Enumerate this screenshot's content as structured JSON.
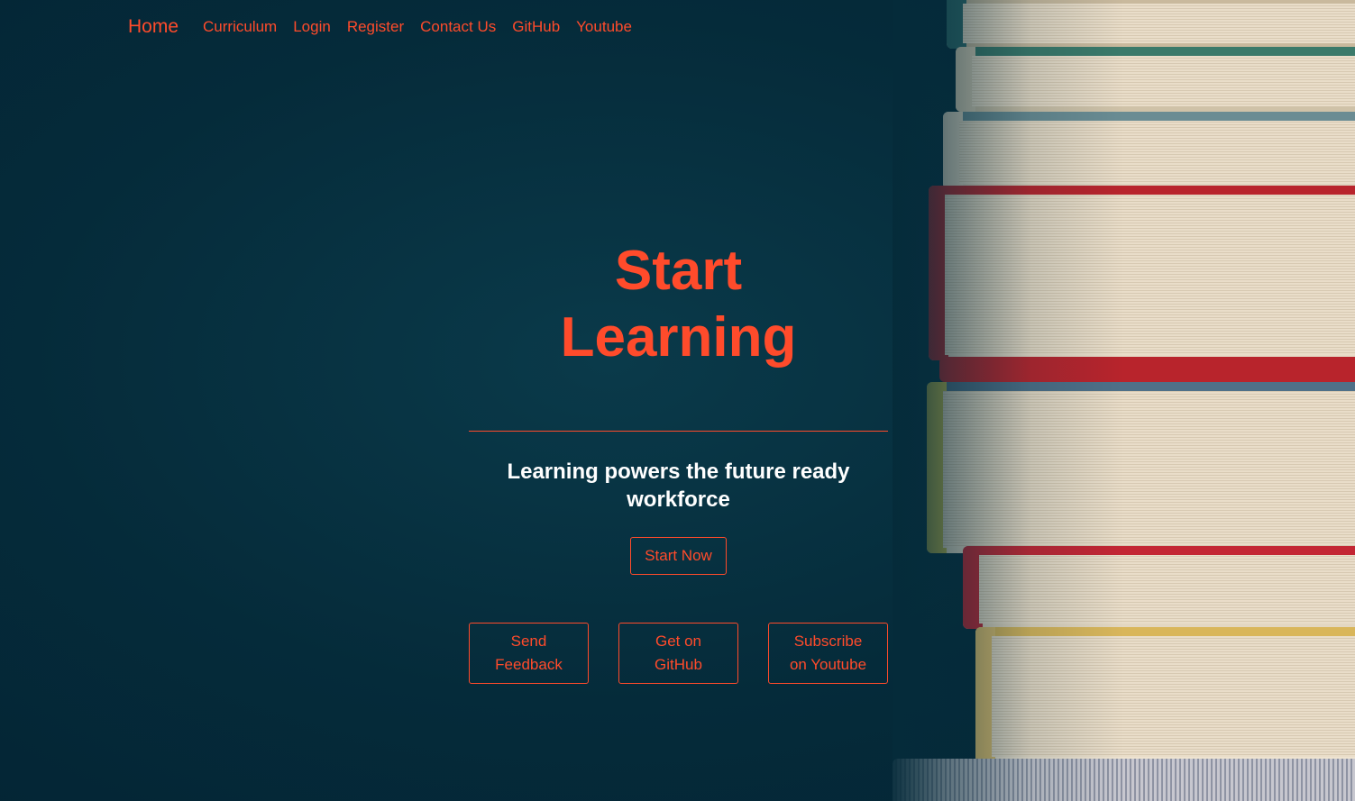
{
  "nav": {
    "brand": "Home",
    "links": [
      "Curriculum",
      "Login",
      "Register",
      "Contact Us",
      "GitHub",
      "Youtube"
    ]
  },
  "hero": {
    "title_line1": "Start",
    "title_line2": "Learning",
    "subtitle": "Learning powers the future ready workforce",
    "start_button": "Start Now",
    "actions": [
      "Send Feedback",
      "Get on GitHub",
      "Subscribe on Youtube"
    ]
  },
  "colors": {
    "accent": "#ff4b2b",
    "background": "#052b3a",
    "text_light": "#ffffff"
  }
}
